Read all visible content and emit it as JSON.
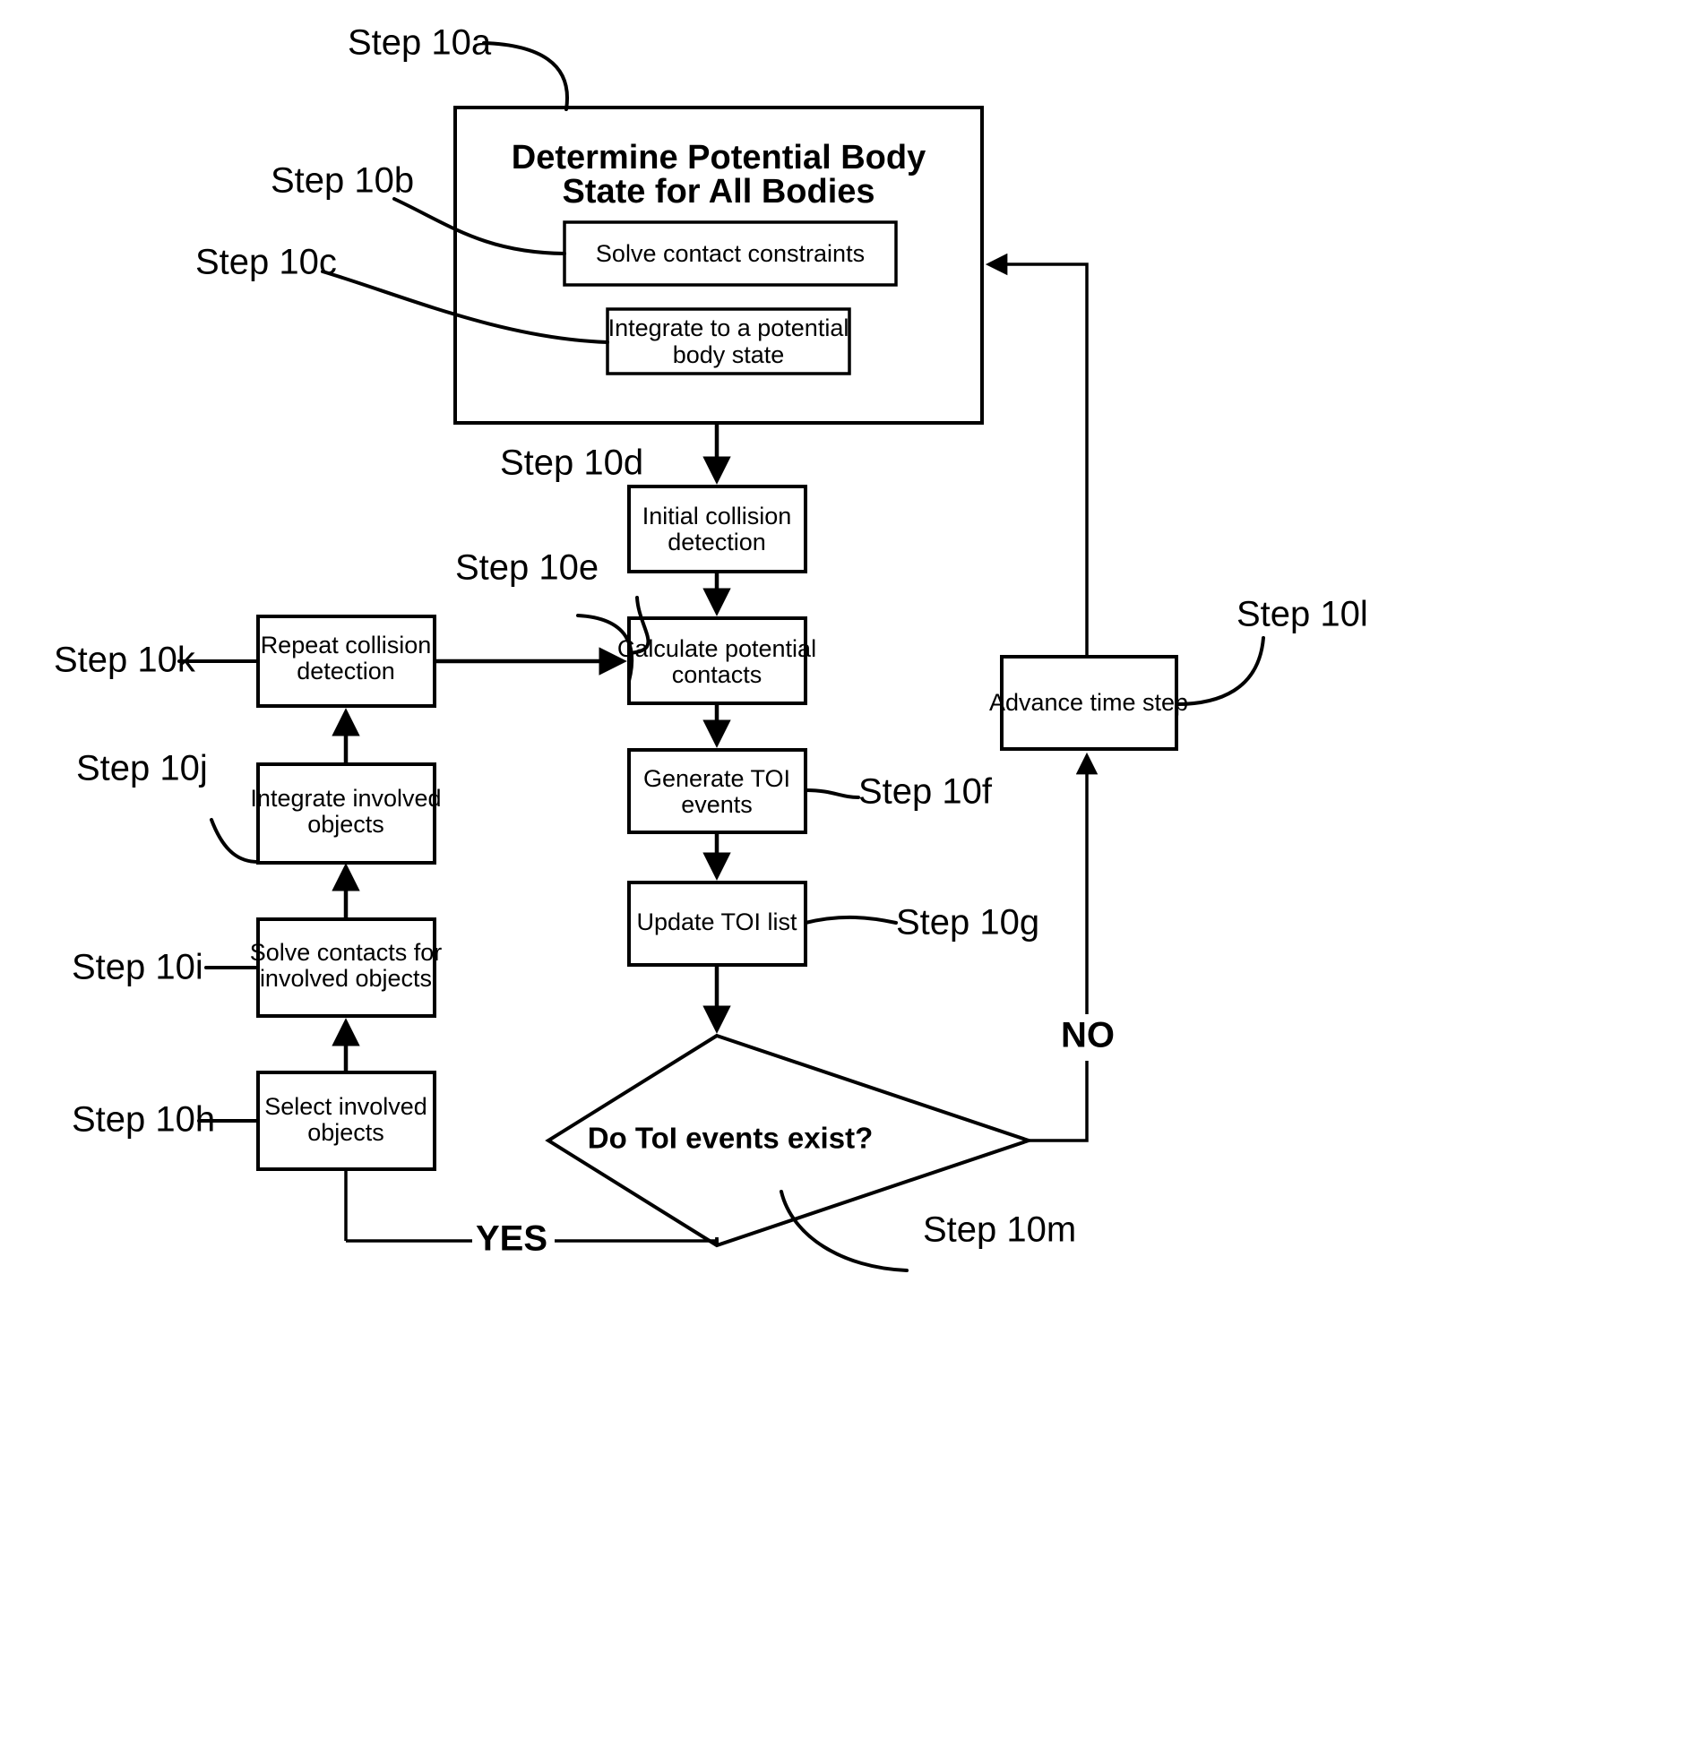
{
  "diagram": {
    "title": "Physics simulation time-step flowchart",
    "background_color": "#ffffff",
    "line_color": "#000000"
  },
  "nodes": {
    "outer_process": {
      "label_line1": "Determine Potential Body",
      "label_line2": "State for All Bodies"
    },
    "solve_contact_constraints": {
      "label": "Solve contact constraints"
    },
    "integrate_potential": {
      "label_line1": "Integrate to a potential",
      "label_line2": "body state"
    },
    "initial_collision_detection": {
      "label_line1": "Initial collision",
      "label_line2": "detection"
    },
    "calculate_potential_contacts": {
      "label_line1": "Calculate potential",
      "label_line2": "contacts"
    },
    "generate_toi_events": {
      "label_line1": "Generate TOI",
      "label_line2": "events"
    },
    "update_toi_list": {
      "label": "Update TOI list"
    },
    "decision_toi": {
      "label": "Do ToI events exist?"
    },
    "advance_time_step": {
      "label": "Advance time step"
    },
    "repeat_collision_detection": {
      "label_line1": "Repeat collision",
      "label_line2": "detection"
    },
    "integrate_involved_objects": {
      "label_line1": "Integrate involved",
      "label_line2": "objects"
    },
    "solve_contacts_involved": {
      "label_line1": "Solve contacts for",
      "label_line2": "involved objects"
    },
    "select_involved_objects": {
      "label_line1": "Select involved",
      "label_line2": "objects"
    }
  },
  "step_labels": {
    "a": "Step 10a",
    "b": "Step 10b",
    "c": "Step 10c",
    "d": "Step 10d",
    "e": "Step 10e",
    "f": "Step 10f",
    "g": "Step 10g",
    "h": "Step 10h",
    "i": "Step 10i",
    "j": "Step 10j",
    "k": "Step 10k",
    "l": "Step 10l",
    "m": "Step 10m"
  },
  "branch_labels": {
    "yes": "YES",
    "no": "NO"
  }
}
